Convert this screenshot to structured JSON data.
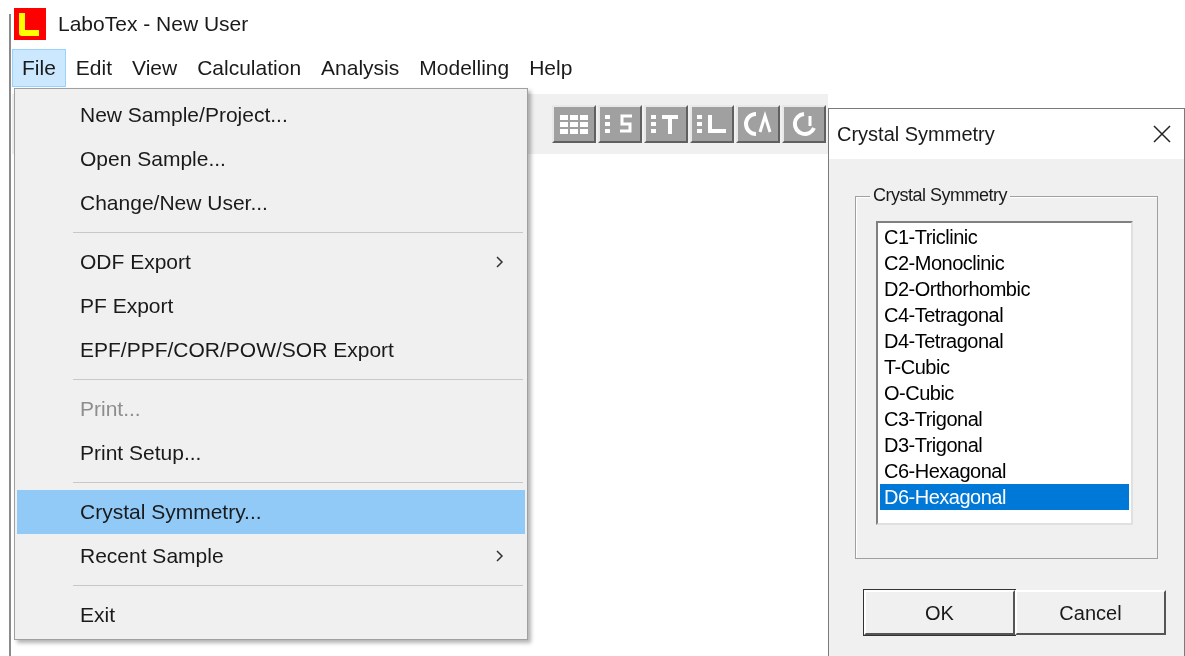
{
  "window": {
    "title": "LaboTex - New User"
  },
  "menu_bar": [
    {
      "label": "File",
      "selected": true
    },
    {
      "label": "Edit",
      "selected": false
    },
    {
      "label": "View",
      "selected": false
    },
    {
      "label": "Calculation",
      "selected": false
    },
    {
      "label": "Analysis",
      "selected": false
    },
    {
      "label": "Modelling",
      "selected": false
    },
    {
      "label": "Help",
      "selected": false
    }
  ],
  "file_menu": [
    {
      "kind": "item",
      "label": "New Sample/Project...",
      "disabled": false,
      "selected": false,
      "submenu": false
    },
    {
      "kind": "item",
      "label": "Open Sample...",
      "disabled": false,
      "selected": false,
      "submenu": false
    },
    {
      "kind": "item",
      "label": "Change/New User...",
      "disabled": false,
      "selected": false,
      "submenu": false
    },
    {
      "kind": "separator"
    },
    {
      "kind": "item",
      "label": "ODF Export",
      "disabled": false,
      "selected": false,
      "submenu": true
    },
    {
      "kind": "item",
      "label": "PF Export",
      "disabled": false,
      "selected": false,
      "submenu": false
    },
    {
      "kind": "item",
      "label": "EPF/PPF/COR/POW/SOR Export",
      "disabled": false,
      "selected": false,
      "submenu": false
    },
    {
      "kind": "separator"
    },
    {
      "kind": "item",
      "label": "Print...",
      "disabled": true,
      "selected": false,
      "submenu": false
    },
    {
      "kind": "item",
      "label": "Print Setup...",
      "disabled": false,
      "selected": false,
      "submenu": false
    },
    {
      "kind": "separator"
    },
    {
      "kind": "item",
      "label": "Crystal Symmetry...",
      "disabled": false,
      "selected": true,
      "submenu": false
    },
    {
      "kind": "item",
      "label": "Recent Sample",
      "disabled": false,
      "selected": false,
      "submenu": true
    },
    {
      "kind": "separator"
    },
    {
      "kind": "item",
      "label": "Exit",
      "disabled": false,
      "selected": false,
      "submenu": false
    }
  ],
  "toolbar": [
    {
      "kind": "grid"
    },
    {
      "kind": "s"
    },
    {
      "kind": "t"
    },
    {
      "kind": "l"
    },
    {
      "kind": "a"
    },
    {
      "kind": "clock"
    }
  ],
  "dialog": {
    "title": "Crystal Symmetry",
    "group_label": "Crystal Symmetry",
    "items": [
      {
        "label": "C1-Triclinic",
        "selected": false
      },
      {
        "label": "C2-Monoclinic",
        "selected": false
      },
      {
        "label": "D2-Orthorhombic",
        "selected": false
      },
      {
        "label": "C4-Tetragonal",
        "selected": false
      },
      {
        "label": "D4-Tetragonal",
        "selected": false
      },
      {
        "label": "T-Cubic",
        "selected": false
      },
      {
        "label": "O-Cubic",
        "selected": false
      },
      {
        "label": "C3-Trigonal",
        "selected": false
      },
      {
        "label": "D3-Trigonal",
        "selected": false
      },
      {
        "label": "C6-Hexagonal",
        "selected": false
      },
      {
        "label": "D6-Hexagonal",
        "selected": true
      }
    ],
    "buttons": [
      "OK",
      "Cancel"
    ]
  }
}
